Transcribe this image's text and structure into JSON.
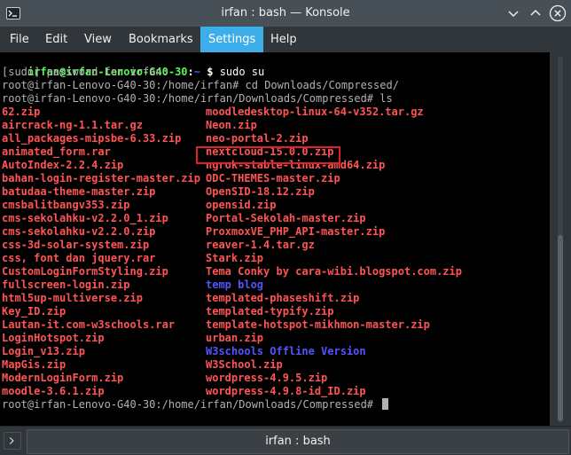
{
  "window": {
    "title": "irfan : bash — Konsole"
  },
  "menu": [
    "File",
    "Edit",
    "View",
    "Bookmarks",
    "Settings",
    "Help"
  ],
  "terminal": {
    "prompt_user": "irfan@irfan-Lenovo-G40-30",
    "prompt_sep": ":",
    "prompt_path": "~",
    "prompt_dollar": " $ ",
    "command1": "sudo su",
    "lines": [
      "[sudo] password for irfan:",
      "root@irfan-Lenovo-G40-30:/home/irfan# cd Downloads/Compressed/",
      "root@irfan-Lenovo-G40-30:/home/irfan/Downloads/Compressed# ls"
    ],
    "col1": [
      {
        "name": "62.zip",
        "color": "red"
      },
      {
        "name": "aircrack-ng-1.1.tar.gz",
        "color": "red"
      },
      {
        "name": "all_packages-mipsbe-6.33.zip",
        "color": "red"
      },
      {
        "name": "animated_form.rar",
        "color": "red"
      },
      {
        "name": "AutoIndex-2.2.4.zip",
        "color": "red"
      },
      {
        "name": "bahan-login-register-master.zip",
        "color": "red"
      },
      {
        "name": "batudaa-theme-master.zip",
        "color": "red"
      },
      {
        "name": "cmsbalitbangv353.zip",
        "color": "red"
      },
      {
        "name": "cms-sekolahku-v2.2.0_1.zip",
        "color": "red"
      },
      {
        "name": "cms-sekolahku-v2.2.0.zip",
        "color": "red"
      },
      {
        "name": "css-3d-solar-system.zip",
        "color": "red"
      },
      {
        "name": "css, font dan jquery.rar",
        "color": "red"
      },
      {
        "name": "CustomLoginFormStyling.zip",
        "color": "red"
      },
      {
        "name": "fullscreen-login.zip",
        "color": "red"
      },
      {
        "name": "html5up-multiverse.zip",
        "color": "red"
      },
      {
        "name": "Key_ID.zip",
        "color": "red"
      },
      {
        "name": "Lautan-it.com-w3schools.rar",
        "color": "red"
      },
      {
        "name": "LoginHotspot.zip",
        "color": "red"
      },
      {
        "name": "Login_v13.zip",
        "color": "red"
      },
      {
        "name": "MapGis.zip",
        "color": "red"
      },
      {
        "name": "ModernLoginForm.zip",
        "color": "red"
      },
      {
        "name": "moodle-3.6.1.zip",
        "color": "red"
      }
    ],
    "col2": [
      {
        "name": "moodledesktop-linux-64-v352.tar.gz",
        "color": "red"
      },
      {
        "name": "Neon.zip",
        "color": "red"
      },
      {
        "name": "neo-portal-2.zip",
        "color": "red"
      },
      {
        "name": "nextcloud-15.0.0.zip",
        "color": "red"
      },
      {
        "name": "ngrok-stable-linux-amd64.zip",
        "color": "red"
      },
      {
        "name": "ODC-THEMES-master.zip",
        "color": "red"
      },
      {
        "name": "OpenSID-18.12.zip",
        "color": "red"
      },
      {
        "name": "opensid.zip",
        "color": "red"
      },
      {
        "name": "Portal-Sekolah-master.zip",
        "color": "red"
      },
      {
        "name": "ProxmoxVE_PHP_API-master.zip",
        "color": "red"
      },
      {
        "name": "reaver-1.4.tar.gz",
        "color": "red"
      },
      {
        "name": "Stark.zip",
        "color": "red"
      },
      {
        "name": "Tema Conky by cara-wibi.blogspot.com.zip",
        "color": "red"
      },
      {
        "name": "temp blog",
        "color": "blue"
      },
      {
        "name": "templated-phaseshift.zip",
        "color": "red"
      },
      {
        "name": "templated-typify.zip",
        "color": "red"
      },
      {
        "name": "template-hotspot-mikhmon-master.zip",
        "color": "red"
      },
      {
        "name": "urban.zip",
        "color": "red"
      },
      {
        "name": "W3schools Offline Version",
        "color": "blue"
      },
      {
        "name": "W3School.zip",
        "color": "red"
      },
      {
        "name": "wordpress-4.9.5.zip",
        "color": "red"
      },
      {
        "name": "wordpress-4.9.8-id_ID.zip",
        "color": "red"
      }
    ],
    "final_prompt": "root@irfan-Lenovo-G40-30:/home/irfan/Downloads/Compressed# "
  },
  "tabbar": {
    "tab_label": "irfan : bash"
  },
  "colors": {
    "red": "#ff5454",
    "green": "#54f554",
    "blue": "#5454ff",
    "selection": "#3daee9",
    "highlight_box": "#e0202a"
  },
  "icons": {
    "app": "konsole-icon",
    "min": "minimize-icon",
    "max": "maximize-icon",
    "close": "close-icon",
    "newtab": "new-tab-icon"
  }
}
